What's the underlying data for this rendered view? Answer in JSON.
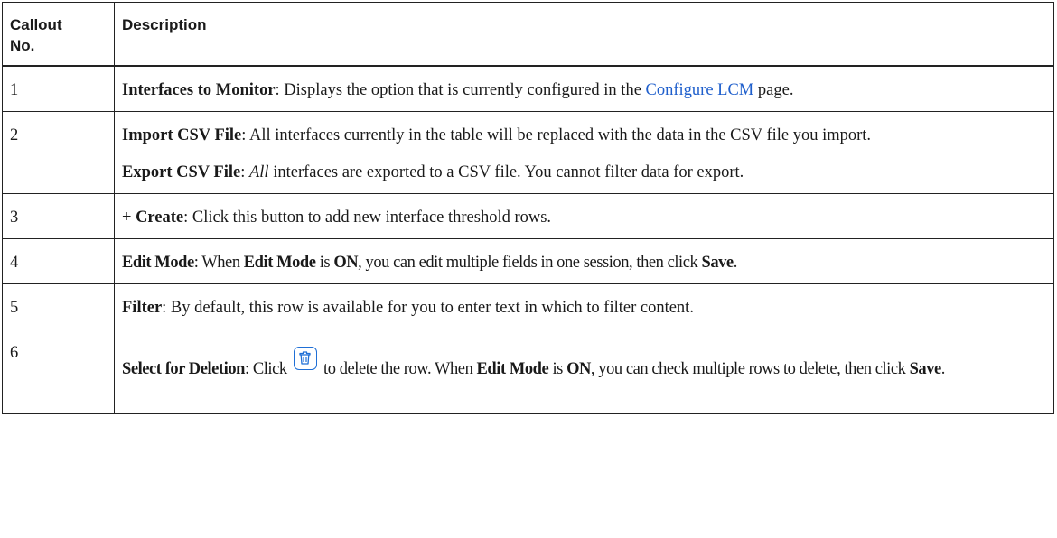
{
  "table": {
    "headers": {
      "callout_line1": "Callout",
      "callout_line2": "No.",
      "description": "Description"
    },
    "rows": [
      {
        "no": "1",
        "term": "Interfaces to Monitor",
        "text_before_link": ": Displays the option that is currently configured in the ",
        "link": "Configure LCM",
        "text_after_link": " page."
      },
      {
        "no": "2",
        "term": "Import CSV File",
        "text": ": All interfaces currently in the table will be replaced with the data in the CSV file you import.",
        "term2": "Export CSV File",
        "text2_pre": ": ",
        "text2_emph": "All",
        "text2_post": " interfaces are exported to a CSV file. You cannot filter data for export."
      },
      {
        "no": "3",
        "prefix": "+ ",
        "term": "Create",
        "text": ": Click this button to add new interface threshold rows."
      },
      {
        "no": "4",
        "term": "Edit Mode",
        "text_a": ": When ",
        "term_b": "Edit Mode",
        "text_b": " is ",
        "term_c": "ON",
        "text_c": ", you can edit multiple fields in one session, then click ",
        "term_d": "Save",
        "text_d": "."
      },
      {
        "no": "5",
        "term": "Filter",
        "text": ": By default, this row is available for you to enter text in which to filter content."
      },
      {
        "no": "6",
        "term": "Select for Deletion",
        "text_a": ": Click ",
        "icon": "trash-icon",
        "text_b": " to delete the row. When ",
        "term_b": "Edit Mode",
        "text_c": " is ",
        "term_c": "ON",
        "text_d": ", you can check multiple rows to delete, then click ",
        "term_d": "Save",
        "text_e": "."
      }
    ]
  },
  "colors": {
    "link": "#1f5fcc",
    "icon_accent": "#1f6fd6",
    "border": "#222222"
  }
}
